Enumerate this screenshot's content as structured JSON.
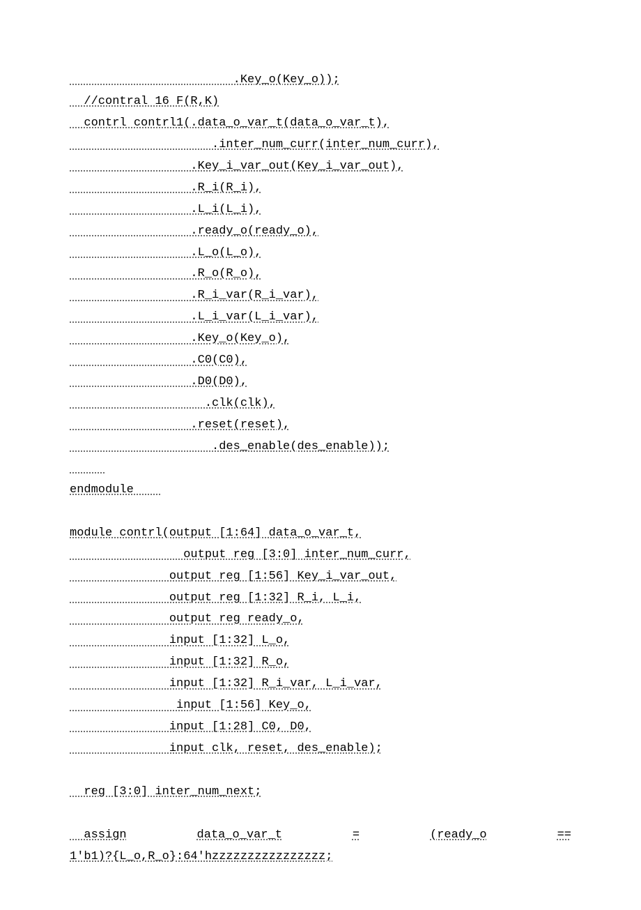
{
  "lines": [
    {
      "type": "code",
      "text": "                       .Key_o(Key_o));"
    },
    {
      "type": "code",
      "text": "  //contral 16 F(R,K)"
    },
    {
      "type": "code",
      "text": "  contrl contrl1(.data_o_var_t(data_o_var_t),"
    },
    {
      "type": "code",
      "text": "                    .inter_num_curr(inter_num_curr),"
    },
    {
      "type": "code",
      "text": "                 .Key_i_var_out(Key_i_var_out),"
    },
    {
      "type": "code",
      "text": "                 .R_i(R_i),"
    },
    {
      "type": "code",
      "text": "                 .L_i(L_i),"
    },
    {
      "type": "code",
      "text": "                 .ready_o(ready_o),"
    },
    {
      "type": "code",
      "text": "                 .L_o(L_o),"
    },
    {
      "type": "code",
      "text": "                 .R_o(R_o),"
    },
    {
      "type": "code",
      "text": "                 .R_i_var(R_i_var),"
    },
    {
      "type": "code",
      "text": "                 .L_i_var(L_i_var),"
    },
    {
      "type": "code",
      "text": "                 .Key_o(Key_o),"
    },
    {
      "type": "code",
      "text": "                 .C0(C0),"
    },
    {
      "type": "code",
      "text": "                 .D0(D0),"
    },
    {
      "type": "code",
      "text": "                   .clk(clk),"
    },
    {
      "type": "code",
      "text": "                 .reset(reset),"
    },
    {
      "type": "code",
      "text": "                    .des_enable(des_enable));"
    },
    {
      "type": "code",
      "text": "     "
    },
    {
      "type": "code",
      "text": "endmodule    "
    },
    {
      "type": "blank"
    },
    {
      "type": "code",
      "text": "module contrl(output [1:64] data_o_var_t,"
    },
    {
      "type": "code",
      "text": "                output reg [3:0] inter_num_curr,"
    },
    {
      "type": "code",
      "text": "              output reg [1:56] Key_i_var_out,"
    },
    {
      "type": "code",
      "text": "              output reg [1:32] R_i, L_i,"
    },
    {
      "type": "code",
      "text": "              output reg ready_o,"
    },
    {
      "type": "code",
      "text": "              input [1:32] L_o,"
    },
    {
      "type": "code",
      "text": "              input [1:32] R_o,"
    },
    {
      "type": "code",
      "text": "              input [1:32] R_i_var, L_i_var,"
    },
    {
      "type": "code",
      "text": "               input [1:56] Key_o,"
    },
    {
      "type": "code",
      "text": "              input [1:28] C0, D0,"
    },
    {
      "type": "code",
      "text": "              input clk, reset, des_enable);"
    },
    {
      "type": "blank"
    },
    {
      "type": "code",
      "text": "  reg [3:0] inter_num_next;"
    },
    {
      "type": "blank"
    },
    {
      "type": "justify",
      "parts": [
        "  assign",
        "data_o_var_t",
        "=",
        "(ready_o",
        "=="
      ]
    },
    {
      "type": "code",
      "text": "1'b1)?{L_o,R_o}:64'hzzzzzzzzzzzzzzzz;"
    }
  ]
}
